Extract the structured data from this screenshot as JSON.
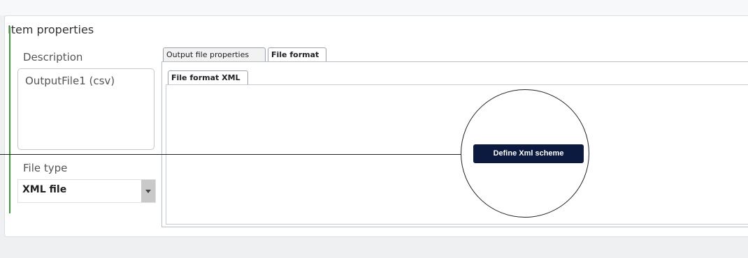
{
  "panel": {
    "title": "Item properties"
  },
  "description": {
    "label": "Description",
    "value": "OutputFile1 (csv)"
  },
  "file_type": {
    "label": "File type",
    "selected": "XML file"
  },
  "tabs": [
    {
      "label": "Output file properties",
      "active": false
    },
    {
      "label": "File format",
      "active": true
    }
  ],
  "subtabs": [
    {
      "label": "File format XML",
      "active": true
    }
  ],
  "callout": {
    "button_label": "Define Xml scheme"
  },
  "colors": {
    "accent_green": "#3c9a3c",
    "button_bg": "#0d1a3f"
  },
  "icons": {
    "dropdown": "chevron-down-icon"
  }
}
